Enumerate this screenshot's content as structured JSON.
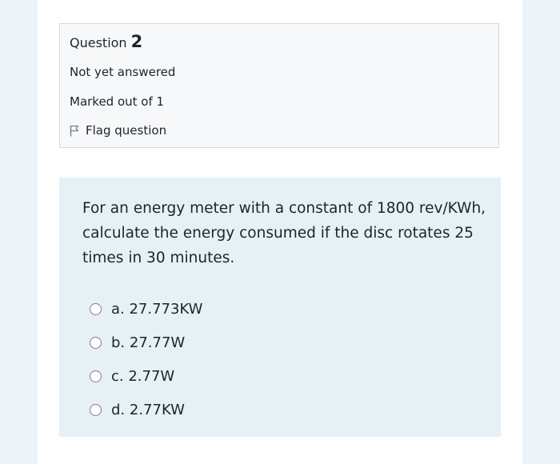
{
  "question_info": {
    "label": "Question",
    "number": "2",
    "status": "Not yet answered",
    "marked": "Marked out of 1",
    "flag_label": "Flag question"
  },
  "question": {
    "text": "For an energy meter with a constant of 1800 rev/KWh, calculate the energy consumed if the disc rotates 25 times in 30 minutes.",
    "options": [
      {
        "label": "a. 27.773KW"
      },
      {
        "label": "b. 27.77W"
      },
      {
        "label": "c. 2.77W"
      },
      {
        "label": "d. 2.77KW"
      }
    ]
  },
  "colors": {
    "background": "#eef3f8",
    "info_box": "#f7f8f9",
    "question_box": "#e6f1f6",
    "text": "#1f2329"
  }
}
